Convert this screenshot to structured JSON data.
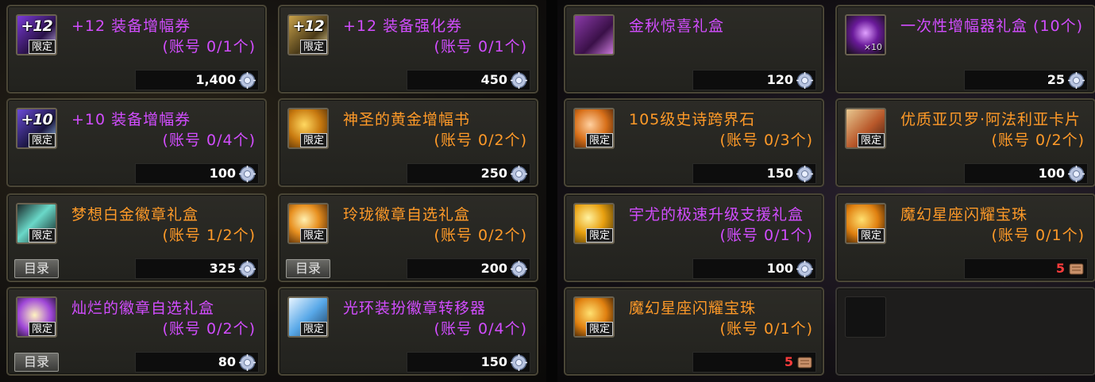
{
  "badge_limited": "限定",
  "catalog_label": "目录",
  "colors": {
    "purple": "#d24dff",
    "orange": "#ff9a28",
    "price_red": "#ff3c3c",
    "price_white": "#ffffff"
  },
  "left_items": [
    {
      "name": "+12 装备增幅券",
      "limit": "(账号 0/1个)",
      "price": "1,400",
      "icon": "amplify-ticket-12-icon",
      "mark": "+12",
      "name_color": "purple",
      "currency": "gear-coin-icon",
      "catalog": false
    },
    {
      "name": "+12 装备强化券",
      "limit": "(账号 0/1个)",
      "price": "450",
      "icon": "reinforce-ticket-12-icon",
      "mark": "+12",
      "name_color": "purple",
      "currency": "gear-coin-icon",
      "catalog": false
    },
    {
      "name": "+10 装备增幅券",
      "limit": "(账号 0/4个)",
      "price": "100",
      "icon": "amplify-ticket-10-icon",
      "mark": "+10",
      "name_color": "purple",
      "currency": "gear-coin-icon",
      "catalog": false
    },
    {
      "name": "神圣的黄金增幅书",
      "limit": "(账号 0/2个)",
      "price": "250",
      "icon": "golden-amplify-book-icon",
      "mark": "",
      "name_color": "orange",
      "currency": "gear-coin-icon",
      "catalog": false
    },
    {
      "name": "梦想白金徽章礼盒",
      "limit": "(账号 1/2个)",
      "price": "325",
      "icon": "platinum-emblem-box-icon",
      "mark": "",
      "name_color": "orange",
      "currency": "gear-coin-icon",
      "catalog": true
    },
    {
      "name": "玲珑徽章自选礼盒",
      "limit": "(账号 0/2个)",
      "price": "200",
      "icon": "emblem-select-box-icon",
      "mark": "",
      "name_color": "orange",
      "currency": "gear-coin-icon",
      "catalog": true
    },
    {
      "name": "灿烂的徽章自选礼盒",
      "limit": "(账号 0/2个)",
      "price": "80",
      "icon": "brilliant-emblem-box-icon",
      "mark": "",
      "name_color": "purple",
      "currency": "gear-coin-icon",
      "catalog": true
    },
    {
      "name": "光环装扮徽章转移器",
      "limit": "(账号 0/4个)",
      "price": "150",
      "icon": "aura-emblem-transfer-icon",
      "mark": "",
      "name_color": "purple",
      "currency": "gear-coin-icon",
      "catalog": false
    }
  ],
  "right_items": [
    {
      "name": "金秋惊喜礼盒",
      "limit": "",
      "price": "120",
      "icon": "autumn-surprise-box-icon",
      "mark": "",
      "name_color": "purple",
      "currency": "gear-coin-icon",
      "count": "",
      "limited": false
    },
    {
      "name": "一次性增幅器礼盒 (10个)",
      "limit": "",
      "price": "25",
      "icon": "amplifier-box-icon",
      "mark": "",
      "name_color": "purple",
      "currency": "gear-coin-icon",
      "count": "×10",
      "limited": false
    },
    {
      "name": "105级史诗跨界石",
      "limit": "(账号 0/3个)",
      "price": "150",
      "icon": "epic-transfer-stone-icon",
      "mark": "",
      "name_color": "orange",
      "currency": "gear-coin-icon",
      "count": "",
      "limited": true
    },
    {
      "name": "优质亚贝罗·阿法利亚卡片",
      "limit": "(账号 0/2个)",
      "price": "100",
      "icon": "abelo-card-icon",
      "mark": "",
      "name_color": "orange",
      "currency": "gear-coin-icon",
      "count": "",
      "limited": true
    },
    {
      "name": "宇尤的极速升级支援礼盒",
      "limit": "(账号 0/1个)",
      "price": "100",
      "icon": "level-up-support-box-icon",
      "mark": "",
      "name_color": "purple",
      "currency": "gear-coin-icon",
      "count": "",
      "limited": true
    },
    {
      "name": "魔幻星座闪耀宝珠",
      "limit": "(账号 0/1个)",
      "price": "5",
      "icon": "constellation-orb-icon",
      "mark": "",
      "name_color": "orange",
      "currency": "scroll-currency-icon",
      "count": "",
      "limited": true
    },
    {
      "name": "魔幻星座闪耀宝珠",
      "limit": "(账号 0/1个)",
      "price": "5",
      "icon": "constellation-orb-icon",
      "mark": "",
      "name_color": "orange",
      "currency": "scroll-currency-icon",
      "count": "",
      "limited": true
    }
  ]
}
